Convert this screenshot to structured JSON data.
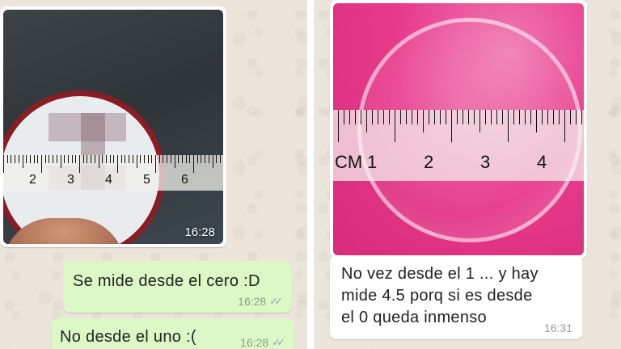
{
  "left_chat": {
    "image_message": {
      "time": "16:28",
      "ruler_numbers": [
        "2",
        "3",
        "4",
        "5",
        "6"
      ]
    },
    "messages": [
      {
        "text": "Se mide desde el cero :D",
        "time": "16:28",
        "status": "read"
      },
      {
        "text": "No desde el uno :(",
        "time": "16:28",
        "status": "read"
      }
    ]
  },
  "right_chat": {
    "image_message": {
      "ruler_unit": "CM",
      "ruler_numbers": [
        "1",
        "2",
        "3",
        "4"
      ]
    },
    "messages": [
      {
        "text_lines": [
          "No vez desde el 1 ...  y hay",
          "mide 4.5  porq si es desde",
          "el 0 queda inmenso"
        ],
        "time": "16:31"
      }
    ]
  },
  "colors": {
    "chat_background": "#ece5dc",
    "outgoing_bubble": "#dcf8c6",
    "incoming_bubble": "#ffffff",
    "read_ticks": "#8fa5b5",
    "photo_pink": "#e83a8c"
  },
  "icons": {
    "read_receipt": "double-check-icon"
  }
}
